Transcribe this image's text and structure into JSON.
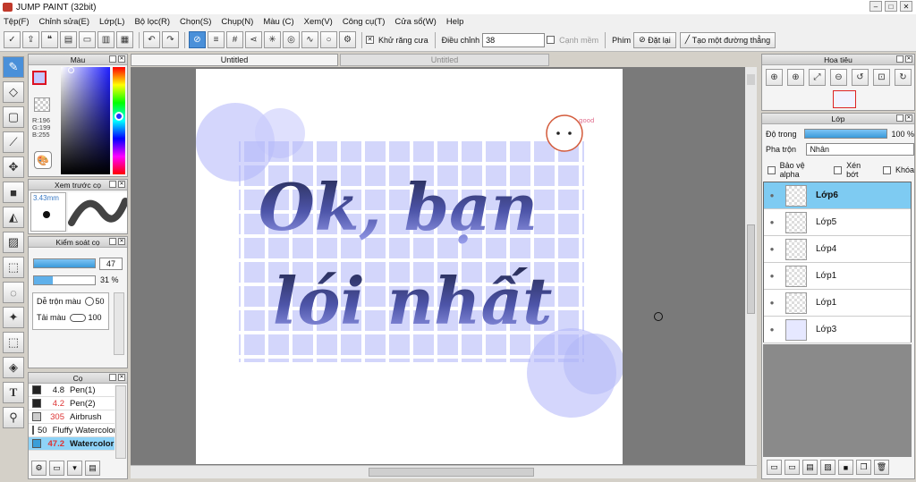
{
  "window": {
    "title": "JUMP PAINT (32bit)"
  },
  "menu": [
    "Tệp(F)",
    "Chỉnh sửa(E)",
    "Lớp(L)",
    "Bộ lọc(R)",
    "Chọn(S)",
    "Chụp(N)",
    "Màu (C)",
    "Xem(V)",
    "Công cụ(T)",
    "Cửa sổ(W)",
    "Help"
  ],
  "toolbar": {
    "antialias_label": "Khử răng cưa",
    "adjust_label": "Điều chỉnh",
    "adjust_value": "38",
    "edge_label": "Cạnh mềm",
    "key_label": "Phím",
    "reset_label": "Đặt lại",
    "create_line_label": "Tạo một đường thẳng"
  },
  "color_panel": {
    "title": "Màu",
    "r": "R:196",
    "g": "G:199",
    "b": "B:255"
  },
  "preview_panel": {
    "title": "Xem trước cọ",
    "size": "3.43mm"
  },
  "brush_control": {
    "title": "Kiểm soát cọ",
    "size_value": "47",
    "opacity_value": "31",
    "opacity_unit": "%",
    "blend_label": "Dễ trộn màu",
    "blend_value": "50",
    "reload_label": "Tải màu",
    "reload_value": "100"
  },
  "brush_list": {
    "title": "Cọ",
    "items": [
      {
        "size": "4.8",
        "name": "Pen(1)",
        "color": "#222222"
      },
      {
        "size": "4.2",
        "name": "Pen(2)",
        "color": "#222222"
      },
      {
        "size": "305",
        "name": "Airbrush",
        "color": "#cccccc"
      },
      {
        "size": "50",
        "name": "Fluffy Watercolor",
        "color": "#bfe08a"
      },
      {
        "size": "47.2",
        "name": "Watercolor",
        "color": "#3a9ed8"
      }
    ]
  },
  "tabs": {
    "active": "Untitled",
    "inactive": "Untitled"
  },
  "navigator": {
    "title": "Hoa tiêu"
  },
  "layers_panel": {
    "title": "Lớp",
    "opacity_label": "Độ trong",
    "opacity_value": "100 %",
    "blend_label": "Pha trộn",
    "blend_value": "Nhân",
    "protect_alpha": "Bảo vệ alpha",
    "clipping": "Xén bớt",
    "lock": "Khóa",
    "layers": [
      "Lớp6",
      "Lớp5",
      "Lớp4",
      "Lớp1",
      "Lớp1",
      "Lớp3"
    ]
  },
  "artwork": {
    "line1": "Ok, bạn",
    "line2": "lói nhất",
    "sticker": "good"
  },
  "colors": {
    "accent": "#4a90d9",
    "selected_layer": "#7ecbf2",
    "art_grid": "#aeb4f7",
    "art_circle": "#c9ccfb"
  }
}
